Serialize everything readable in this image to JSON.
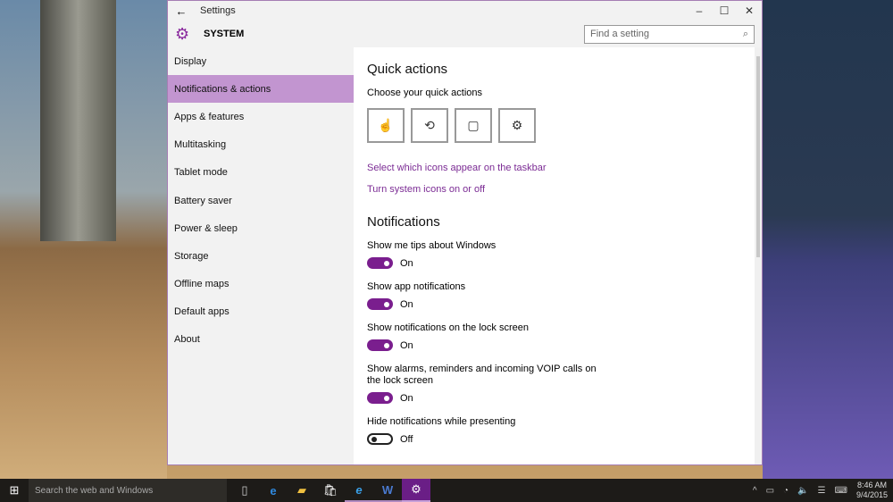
{
  "window": {
    "title": "Settings",
    "section": "SYSTEM",
    "search_placeholder": "Find a setting"
  },
  "sidebar": {
    "items": [
      {
        "label": "Display"
      },
      {
        "label": "Notifications & actions"
      },
      {
        "label": "Apps & features"
      },
      {
        "label": "Multitasking"
      },
      {
        "label": "Tablet mode"
      },
      {
        "label": "Battery saver"
      },
      {
        "label": "Power & sleep"
      },
      {
        "label": "Storage"
      },
      {
        "label": "Offline maps"
      },
      {
        "label": "Default apps"
      },
      {
        "label": "About"
      }
    ],
    "selected": 1
  },
  "quick_actions": {
    "heading": "Quick actions",
    "subheading": "Choose your quick actions",
    "links": [
      "Select which icons appear on the taskbar",
      "Turn system icons on or off"
    ]
  },
  "notifications": {
    "heading": "Notifications",
    "settings": [
      {
        "label": "Show me tips about Windows",
        "state": "On"
      },
      {
        "label": "Show app notifications",
        "state": "On"
      },
      {
        "label": "Show notifications on the lock screen",
        "state": "On"
      },
      {
        "label": "Show alarms, reminders and incoming VOIP calls on the lock screen",
        "state": "On"
      },
      {
        "label": "Hide notifications while presenting",
        "state": "Off"
      }
    ]
  },
  "taskbar": {
    "search_placeholder": "Search the web and Windows",
    "time": "8:46 AM",
    "date": "9/4/2015"
  },
  "colors": {
    "accent": "#7a1e8e",
    "link": "#7b2b94",
    "selected": "#c295d0"
  }
}
